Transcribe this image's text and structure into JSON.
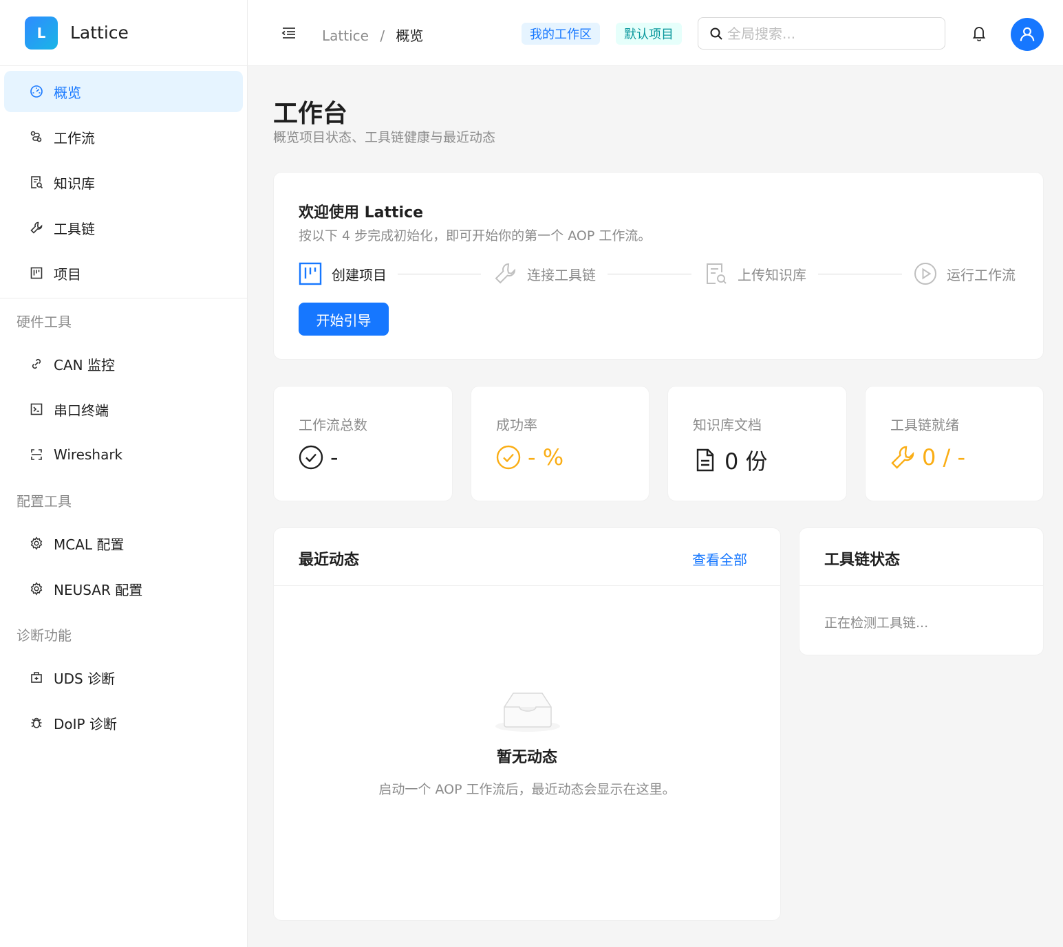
{
  "brand": {
    "logo_letter": "L",
    "name": "Lattice"
  },
  "sidebar": {
    "items": [
      {
        "label": "概览",
        "icon": "dashboard-icon"
      },
      {
        "label": "工作流",
        "icon": "workflow-icon"
      },
      {
        "label": "知识库",
        "icon": "knowledge-icon"
      },
      {
        "label": "工具链",
        "icon": "wrench-icon"
      },
      {
        "label": "项目",
        "icon": "project-icon"
      }
    ],
    "groups": [
      {
        "title": "硬件工具",
        "items": [
          {
            "label": "CAN 监控",
            "icon": "link-icon"
          },
          {
            "label": "串口终端",
            "icon": "terminal-icon"
          },
          {
            "label": "Wireshark",
            "icon": "scan-icon"
          }
        ]
      },
      {
        "title": "配置工具",
        "items": [
          {
            "label": "MCAL 配置",
            "icon": "gear-icon"
          },
          {
            "label": "NEUSAR 配置",
            "icon": "gear-icon"
          }
        ]
      },
      {
        "title": "诊断功能",
        "items": [
          {
            "label": "UDS 诊断",
            "icon": "medical-box-icon"
          },
          {
            "label": "DoIP 诊断",
            "icon": "bug-icon"
          }
        ]
      }
    ],
    "active_color": "#1677ff"
  },
  "header": {
    "breadcrumb": {
      "root": "Lattice",
      "separator": "/",
      "current": "概览"
    },
    "workspace_tag": "我的工作区",
    "project_tag": "默认项目",
    "search_placeholder": "全局搜索..."
  },
  "page": {
    "title": "工作台",
    "subtitle": "概览项目状态、工具链健康与最近动态"
  },
  "welcome": {
    "title": "欢迎使用 Lattice",
    "subtitle": "按以下 4 步完成初始化，即可开始你的第一个 AOP 工作流。",
    "steps": [
      {
        "label": "创建项目",
        "icon": "project-icon",
        "active": true
      },
      {
        "label": "连接工具链",
        "icon": "wrench-icon",
        "active": false
      },
      {
        "label": "上传知识库",
        "icon": "knowledge-icon",
        "active": false
      },
      {
        "label": "运行工作流",
        "icon": "play-circle-icon",
        "active": false
      }
    ],
    "start_button": "开始引导"
  },
  "stats": [
    {
      "label": "工作流总数",
      "value": "-",
      "icon": "check-circle-icon",
      "color": "#1f1f1f"
    },
    {
      "label": "成功率",
      "value": "- %",
      "icon": "check-circle-icon",
      "color": "#faad14"
    },
    {
      "label": "知识库文档",
      "value": "0 份",
      "icon": "file-icon",
      "color": "#1f1f1f"
    },
    {
      "label": "工具链就绪",
      "value": "0 / -",
      "icon": "wrench-icon",
      "color": "#faad14"
    }
  ],
  "activity": {
    "title": "最近动态",
    "view_all": "查看全部",
    "empty_title": "暂无动态",
    "empty_desc": "启动一个 AOP 工作流后，最近动态会显示在这里。"
  },
  "toolchain": {
    "title": "工具链状态",
    "status": "正在检测工具链..."
  }
}
